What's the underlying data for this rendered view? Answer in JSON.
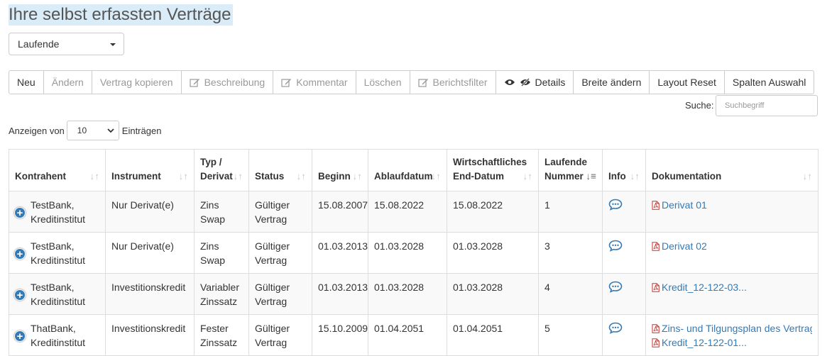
{
  "page": {
    "title": "Ihre selbst erfassten Verträge"
  },
  "filter": {
    "selected": "Laufende"
  },
  "toolbar": {
    "neu": "Neu",
    "aendern": "Ändern",
    "kopieren": "Vertrag kopieren",
    "beschreibung": "Beschreibung",
    "kommentar": "Kommentar",
    "loeschen": "Löschen",
    "berichtsfilter": "Berichtsfilter",
    "details": "Details",
    "breite": "Breite ändern",
    "layout_reset": "Layout Reset",
    "spalten": "Spalten Auswahl"
  },
  "search": {
    "label": "Suche:",
    "placeholder": "Suchbegriff"
  },
  "length": {
    "prefix": "Anzeigen von",
    "value": "10",
    "suffix": "Einträgen"
  },
  "table": {
    "headers": {
      "kontrahent": "Kontrahent",
      "instrument": "Instrument",
      "typ1": "Typ /",
      "typ2": "Derivat",
      "status": "Status",
      "beginn": "Beginn",
      "ablauf": "Ablaufdatum",
      "end1": "Wirtschaftliches",
      "end2": "End-Datum",
      "nr1": "Laufende",
      "nr2": "Nummer",
      "info": "Info",
      "doku": "Dokumentation"
    },
    "rows": [
      {
        "k1": "TestBank,",
        "k2": "Kreditinstitut",
        "instrument": "Nur Derivat(e)",
        "t1": "Zins Swap",
        "t2": "",
        "s1": "Gültiger",
        "s2": "Vertrag",
        "beginn": "15.08.2007",
        "ablauf": "15.08.2022",
        "end": "15.08.2022",
        "nr": "1",
        "docs": [
          "Derivat 01"
        ]
      },
      {
        "k1": "TestBank,",
        "k2": "Kreditinstitut",
        "instrument": "Nur Derivat(e)",
        "t1": "Zins Swap",
        "t2": "",
        "s1": "Gültiger",
        "s2": "Vertrag",
        "beginn": "01.03.2013",
        "ablauf": "01.03.2028",
        "end": "01.03.2028",
        "nr": "3",
        "docs": [
          "Derivat 02"
        ]
      },
      {
        "k1": "TestBank,",
        "k2": "Kreditinstitut",
        "instrument": "Investitionskredit",
        "t1": "Variabler",
        "t2": "Zinssatz",
        "s1": "Gültiger",
        "s2": "Vertrag",
        "beginn": "01.03.2013",
        "ablauf": "01.03.2028",
        "end": "01.03.2028",
        "nr": "4",
        "docs": [
          "Kredit_12-122-03..."
        ]
      },
      {
        "k1": "ThatBank,",
        "k2": "Kreditinstitut",
        "instrument": "Investitionskredit",
        "t1": "Fester",
        "t2": "Zinssatz",
        "s1": "Gültiger",
        "s2": "Vertrag",
        "beginn": "15.10.2009",
        "ablauf": "01.04.2051",
        "end": "01.04.2051",
        "nr": "5",
        "docs": [
          "Zins- und Tilgungsplan des Vertrags...",
          "Kredit_12-122-01..."
        ]
      }
    ]
  }
}
